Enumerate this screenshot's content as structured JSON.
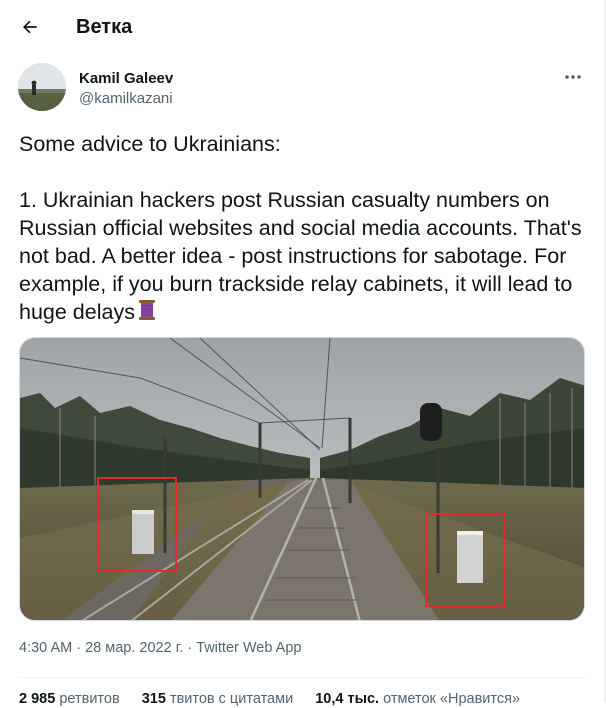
{
  "header": {
    "title": "Ветка"
  },
  "author": {
    "name": "Kamil Galeev",
    "handle": "@kamilkazani"
  },
  "tweet": {
    "text": "Some advice to Ukrainians:\n\n1. Ukrainian hackers post Russian casualty numbers on Russian official websites and social media accounts. That's not bad. A better idea - post instructions for sabotage. For example, if you burn trackside relay cabinets, it will lead to huge delays",
    "emoji": "🧵"
  },
  "meta": {
    "time": "4:30 AM",
    "separator1": " · ",
    "date": "28 мар. 2022 г.",
    "separator2": " · ",
    "source": "Twitter Web App"
  },
  "stats": {
    "retweets_count": "2 985",
    "retweets_label": "ретвитов",
    "quotes_count": "315",
    "quotes_label": "твитов с цитатами",
    "likes_count": "10,4 тыс.",
    "likes_label": "отметок «Нравится»"
  },
  "icons": {
    "back": "arrow-left-icon",
    "more": "more-horizontal-icon",
    "emoji": "thread-spool-icon"
  },
  "colors": {
    "text": "#0f1419",
    "secondary": "#536471",
    "highlight_box": "#e02b2b"
  }
}
